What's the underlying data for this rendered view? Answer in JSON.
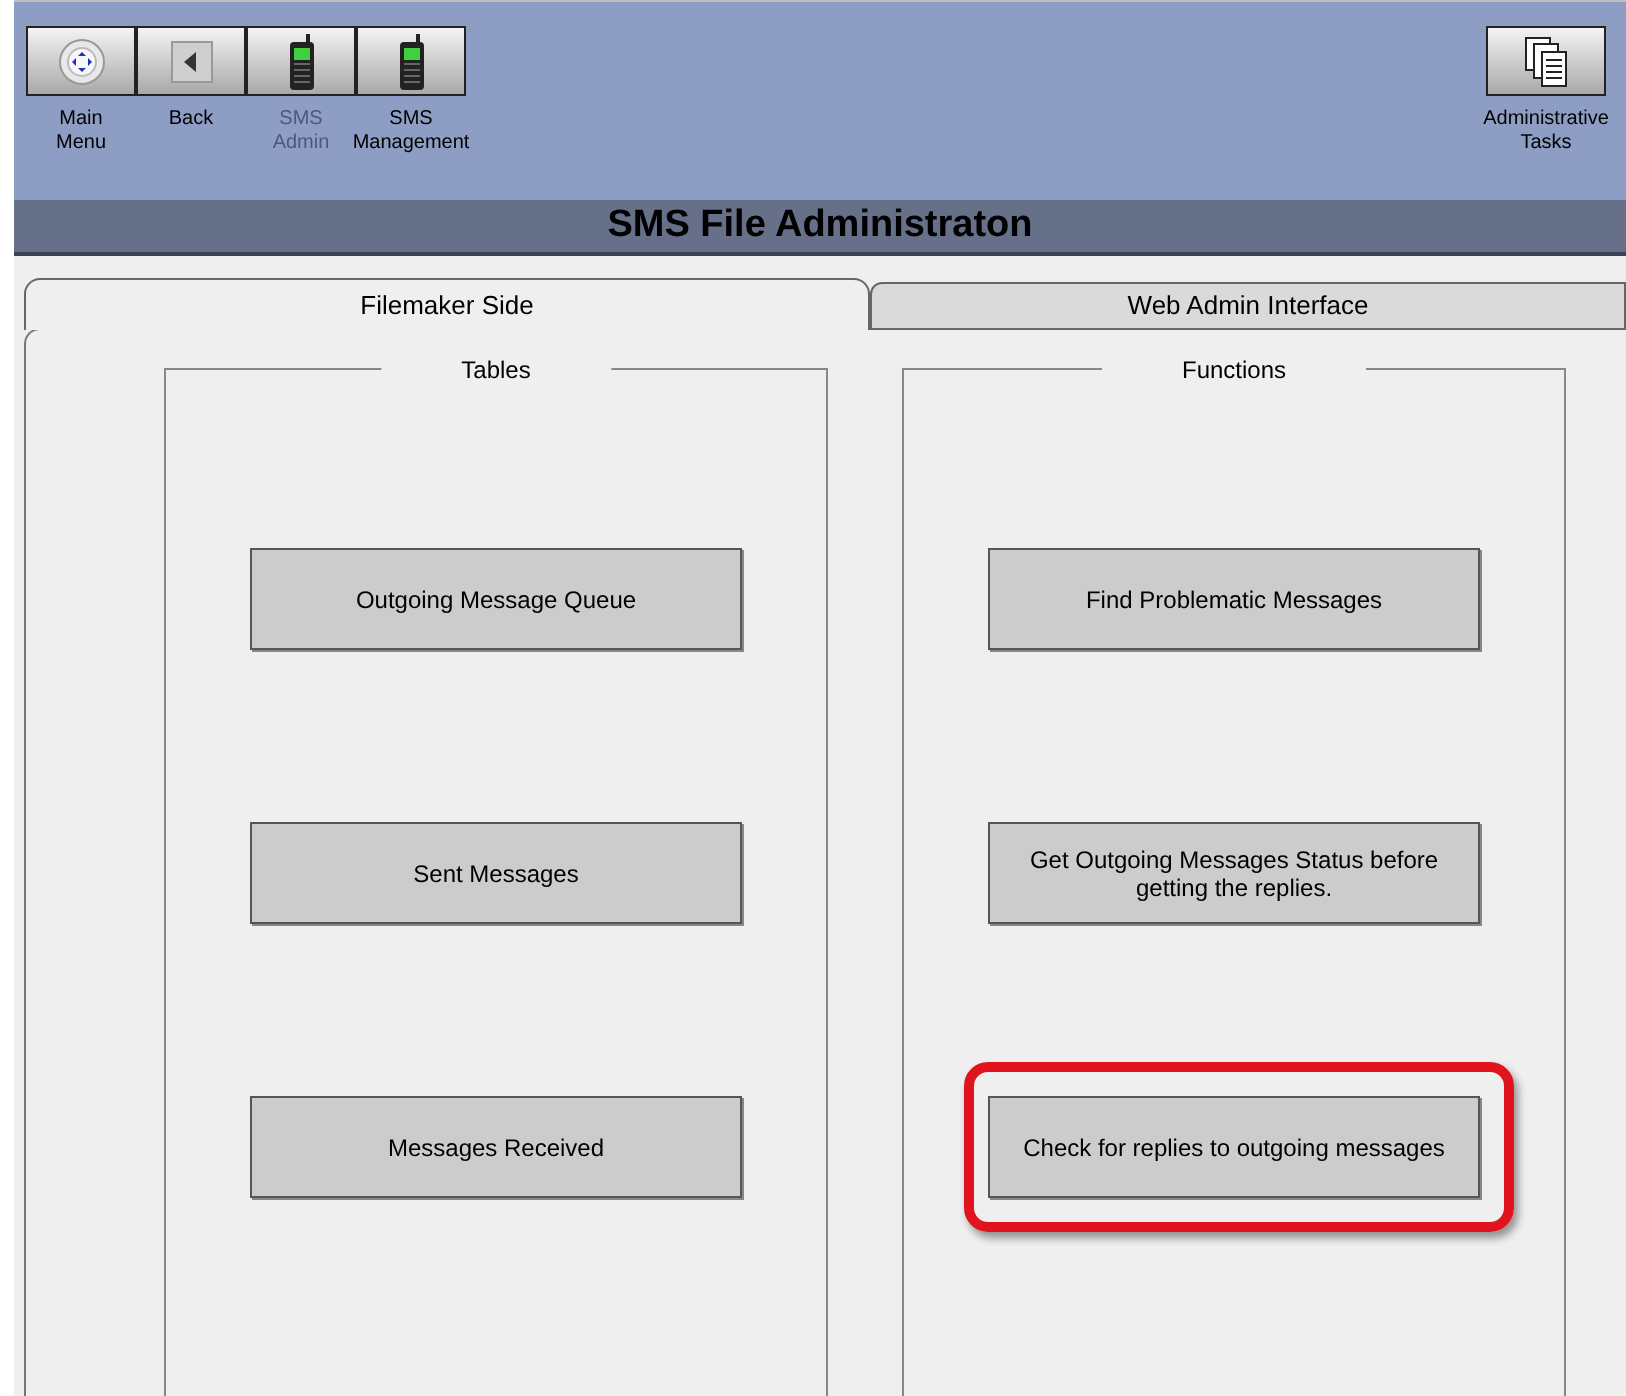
{
  "toolbar": {
    "buttons": [
      {
        "kind": "main",
        "label": "Main\nMenu",
        "disabled": false
      },
      {
        "kind": "back",
        "label": "Back",
        "disabled": false
      },
      {
        "kind": "phone",
        "label": "SMS\nAdmin",
        "disabled": true
      },
      {
        "kind": "phone",
        "label": "SMS\nManagement",
        "disabled": false
      }
    ],
    "right_button": {
      "kind": "docs",
      "label": "Administrative\nTasks"
    }
  },
  "title": "SMS File Administraton",
  "tabs": [
    {
      "label": "Filemaker Side",
      "selected": true
    },
    {
      "label": "Web Admin Interface",
      "selected": false
    }
  ],
  "groups": [
    {
      "title": "Tables",
      "buttons": [
        {
          "label": "Outgoing Message Queue",
          "highlighted": false
        },
        {
          "label": "Sent Messages",
          "highlighted": false
        },
        {
          "label": "Messages Received",
          "highlighted": false
        }
      ]
    },
    {
      "title": "Functions",
      "buttons": [
        {
          "label": "Find Problematic Messages",
          "highlighted": false
        },
        {
          "label": "Get Outgoing Messages Status before getting the replies.",
          "highlighted": false
        },
        {
          "label": "Check for replies to outgoing messages",
          "highlighted": true
        }
      ]
    }
  ]
}
